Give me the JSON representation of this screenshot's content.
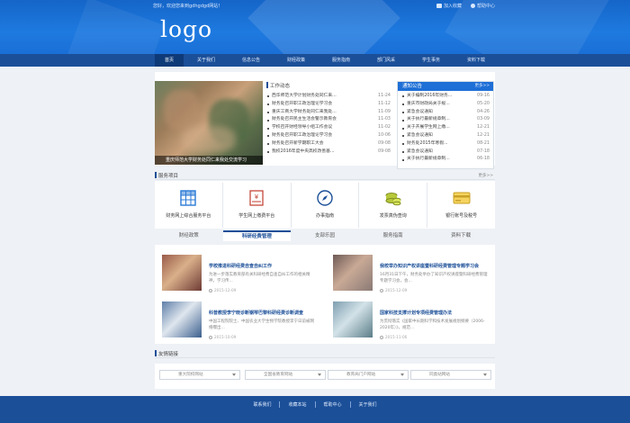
{
  "topbar": {
    "welcome": "您好，欢迎您来到gdhgdgd网站！",
    "favorite": "加入收藏",
    "help": "帮助中心"
  },
  "logo": "logo",
  "nav": [
    "首页",
    "关于我们",
    "信息公告",
    "财经政策",
    "服务指南",
    "部门风采",
    "学生事务",
    "资料下载"
  ],
  "hero": {
    "caption": "重庆师范大学财务处同仁来我处交流学习"
  },
  "work": {
    "title": "工作动态",
    "items": [
      {
        "text": "西华师范大学计划财务处同仁来...",
        "date": "11-24"
      },
      {
        "text": "财务处召开职工政治理论学习会",
        "date": "11-12"
      },
      {
        "text": "重庆工商大学财务处同仁来我处...",
        "date": "11-09"
      },
      {
        "text": "财务处召开民主生活会警示教育会",
        "date": "11-03"
      },
      {
        "text": "学校召开财经领导小组工作会议",
        "date": "11-02"
      },
      {
        "text": "财务处召开职工政治理论学习会",
        "date": "10-06"
      },
      {
        "text": "财务处召开新学期职工大会",
        "date": "09-08"
      },
      {
        "text": "我校2016年度中央高校改善基...",
        "date": "09-08"
      }
    ]
  },
  "notice": {
    "title": "通知公告",
    "more": "更多>>",
    "items": [
      {
        "text": "关于编制2016年财务...",
        "date": "09-16"
      },
      {
        "text": "重庆市财政局关于规...",
        "date": "05-20"
      },
      {
        "text": "紧急会议通知",
        "date": "04-26"
      },
      {
        "text": "关于执行最新规章制...",
        "date": "03-09"
      },
      {
        "text": "关于开展学生网上缴...",
        "date": "12-21"
      },
      {
        "text": "紧急会议通知",
        "date": "12-21"
      },
      {
        "text": "财务处2015年寒假...",
        "date": "08-21"
      },
      {
        "text": "紧急会议通知",
        "date": "07-18"
      },
      {
        "text": "关于执行最新规章制...",
        "date": "06-18"
      }
    ]
  },
  "services": {
    "title": "服务项目",
    "more": "更多>>",
    "items": [
      {
        "label": "财务网上综合服务平台"
      },
      {
        "label": "学生网上缴费平台"
      },
      {
        "label": "办事指南"
      },
      {
        "label": "发票真伪查询"
      },
      {
        "label": "银行账号及税号"
      }
    ]
  },
  "tabs": [
    "财经政策",
    "科研经费管理",
    "支部乐园",
    "服务指南",
    "资料下载"
  ],
  "articles": [
    {
      "title": "学校推进科研经费自查自纠工作",
      "desc": "为进一步落实教育部有关科研经费自查自纠工作的相关精神，学习传...",
      "date": "2015-12-09"
    },
    {
      "title": "我校举办知识产权讲座暨科研经费管理专题学习会",
      "desc": "16月31日下午，财务处举办了知识产权讲座暨科研经费管理专题学习会，会...",
      "date": "2015-12-09"
    },
    {
      "title": "科普教授李宁晓诊断钢琴巴黎科研经费诊断调查",
      "desc": "中国工程院院士、中国农业大学生物学院教授李宁日前被网络曝出...",
      "date": "2015-10-09"
    },
    {
      "title": "国家科技支撑计划专项经费管理办法",
      "desc": "为贯彻落实《国家中长期科学和技术发展规划纲要（2006-2020年）》，规范...",
      "date": "2015-11-06"
    }
  ],
  "links": {
    "title": "友情链接",
    "selects": [
      "重大院校网站",
      "全国省教育网站",
      "教育局门户网站",
      "同类站网站"
    ]
  },
  "footer": {
    "links": [
      "联系我们",
      "收藏本站",
      "帮助中心",
      "关于我们"
    ]
  },
  "colors": {
    "primary": "#1b4f98",
    "header": "#1e7ae0",
    "accent": "#1e6fd6"
  }
}
